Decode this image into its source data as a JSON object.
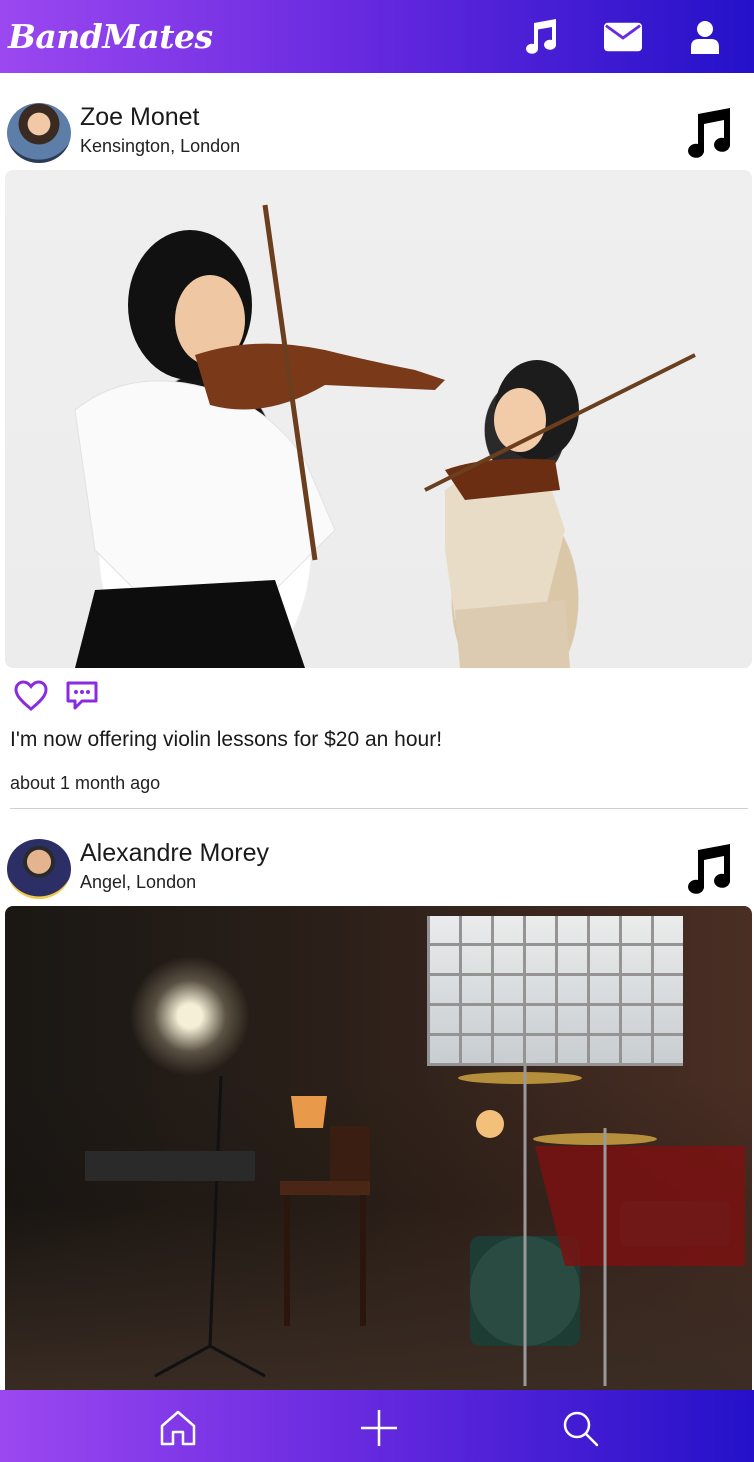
{
  "app": {
    "title": "BandMates"
  },
  "header_icons": [
    "music-icon",
    "envelope-icon",
    "user-icon"
  ],
  "posts": [
    {
      "user": "Zoe Monet",
      "location": "Kensington, London",
      "type_icon": "music-icon",
      "image": "two violinists photo",
      "text": "I'm now offering violin lessons for $20 an hour!",
      "time": "about 1 month ago"
    },
    {
      "user": "Alexandre Morey",
      "location": "Angel, London",
      "type_icon": "music-icon",
      "image": "music studio with drums photo"
    }
  ],
  "bottom_nav": [
    "home-icon",
    "plus-icon",
    "search-icon"
  ],
  "colors": {
    "gradient_start": "#9b48f0",
    "gradient_end": "#2411c9",
    "accent": "#8a2be2"
  }
}
